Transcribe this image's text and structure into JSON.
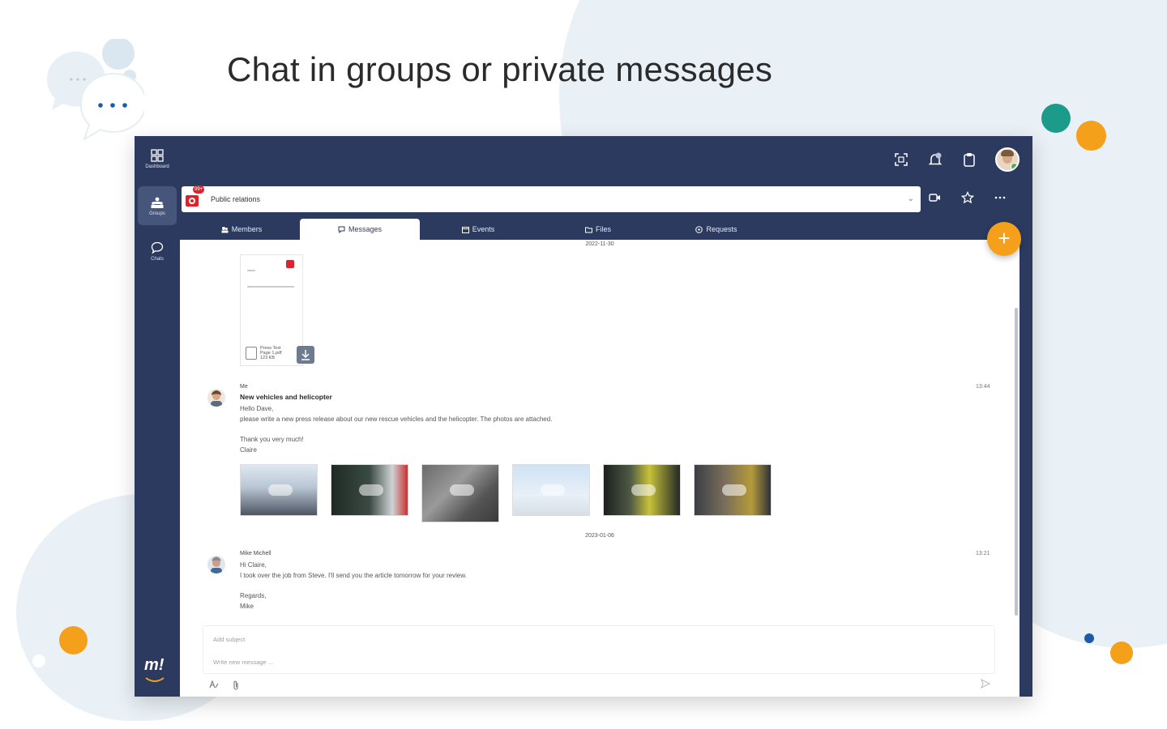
{
  "headline": "Chat in groups or private messages",
  "colors": {
    "navy": "#2b3a5e",
    "accent": "#f5a01a",
    "teal": "#1c9a8a",
    "blob": "#eaf1f6"
  },
  "rail": {
    "items": [
      {
        "label": "Dashboard",
        "icon": "dashboard-icon"
      },
      {
        "label": "Groups",
        "icon": "groups-icon"
      },
      {
        "label": "Chats",
        "icon": "chat-icon"
      }
    ],
    "logo_text": "m!"
  },
  "topbar": {
    "icons": [
      "scan-icon",
      "notification-bell-icon",
      "clipboard-icon",
      "avatar"
    ]
  },
  "group": {
    "name": "Public relations",
    "badge": "99+"
  },
  "header_actions": [
    "video-call-icon",
    "star-icon",
    "more-icon"
  ],
  "tabs": [
    {
      "label": "Members",
      "icon": "members-icon"
    },
    {
      "label": "Messages",
      "icon": "messages-icon",
      "active": true
    },
    {
      "label": "Events",
      "icon": "events-icon"
    },
    {
      "label": "Files",
      "icon": "files-icon"
    },
    {
      "label": "Requests",
      "icon": "requests-icon"
    }
  ],
  "dates": [
    "2022-11-30",
    "2023-01-06"
  ],
  "attachment": {
    "file_lines": [
      "Press Text",
      "Page 1.pdf",
      "123 KB"
    ]
  },
  "messages": [
    {
      "sender": "Me",
      "subject": "New vehicles and helicopter",
      "time": "13:44",
      "lines": [
        "Hello Dave,",
        "please write a new press release about our new rescue vehicles and the helicopter. The photos are attached.",
        "Thank you very much!",
        "Claire"
      ],
      "photos": [
        "vehicle",
        "ambulance",
        "rescue",
        "helicopter",
        "team",
        "equipment"
      ]
    },
    {
      "sender": "Mike Michell",
      "time": "13:21",
      "lines": [
        "Hi Claire,",
        "I took over the job from Steve. I'll send you the article tomorrow for your review.",
        "Regards,",
        "Mike"
      ]
    }
  ],
  "composer": {
    "subject_placeholder": "Add subject",
    "message_placeholder": "Write new message ..."
  }
}
